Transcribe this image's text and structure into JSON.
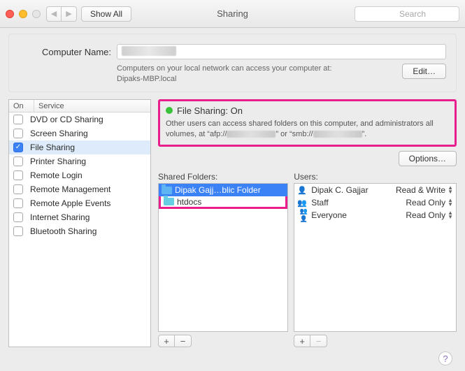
{
  "titlebar": {
    "title": "Sharing",
    "show_all": "Show All",
    "search_placeholder": "Search"
  },
  "computer_name": {
    "label": "Computer Name:",
    "value": "",
    "hint_line1": "Computers on your local network can access your computer at:",
    "hint_line2": "Dipaks-MBP.local",
    "edit_label": "Edit…"
  },
  "services": {
    "header_on": "On",
    "header_service": "Service",
    "items": [
      {
        "checked": false,
        "label": "DVD or CD Sharing"
      },
      {
        "checked": false,
        "label": "Screen Sharing"
      },
      {
        "checked": true,
        "label": "File Sharing",
        "selected": true
      },
      {
        "checked": false,
        "label": "Printer Sharing"
      },
      {
        "checked": false,
        "label": "Remote Login"
      },
      {
        "checked": false,
        "label": "Remote Management"
      },
      {
        "checked": false,
        "label": "Remote Apple Events"
      },
      {
        "checked": false,
        "label": "Internet Sharing"
      },
      {
        "checked": false,
        "label": "Bluetooth Sharing"
      }
    ]
  },
  "status": {
    "title": "File Sharing: On",
    "desc_prefix": "Other users can access shared folders on this computer, and administrators all volumes, at “afp://",
    "desc_mid": "” or “smb://",
    "desc_suffix": "”.",
    "options_label": "Options…"
  },
  "shared_folders": {
    "label": "Shared Folders:",
    "items": [
      {
        "label": "Dipak Gajj…blic Folder",
        "selected": true,
        "color": "blue"
      },
      {
        "label": "htdocs",
        "selected": false,
        "color": "teal",
        "highlight": true
      }
    ]
  },
  "users": {
    "label": "Users:",
    "items": [
      {
        "icon": "person",
        "name": "Dipak C. Gajjar",
        "perm": "Read & Write"
      },
      {
        "icon": "pair",
        "name": "Staff",
        "perm": "Read Only"
      },
      {
        "icon": "group",
        "name": "Everyone",
        "perm": "Read Only"
      }
    ]
  },
  "footer": {
    "help_tooltip": "?"
  }
}
